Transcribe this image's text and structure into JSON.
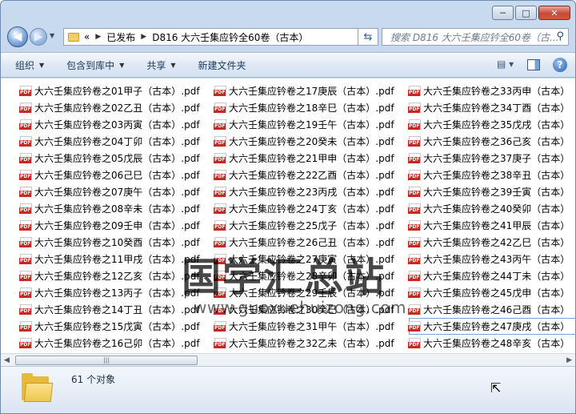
{
  "window": {
    "minimize": "─",
    "maximize": "□",
    "close": "✕"
  },
  "nav": {
    "back_icon": "back-arrow-icon",
    "forward_icon": "forward-arrow-icon"
  },
  "address": {
    "overflow": "«",
    "crumbs": [
      "已发布",
      "D816 大六壬集应钤全60卷（古本）"
    ]
  },
  "search": {
    "placeholder": "搜索 D816 大六壬集应钤全60卷（古..."
  },
  "toolbar": {
    "organize": "组织",
    "include_in_library": "包含到库中",
    "share": "共享",
    "new_folder": "新建文件夹"
  },
  "files": {
    "col1": [
      "大六壬集应钤卷之01甲子（古本）.pdf",
      "大六壬集应钤卷之02乙丑（古本）.pdf",
      "大六壬集应钤卷之03丙寅（古本）.pdf",
      "大六壬集应钤卷之04丁卯（古本）.pdf",
      "大六壬集应钤卷之05戊辰（古本）.pdf",
      "大六壬集应钤卷之06己巳（古本）.pdf",
      "大六壬集应钤卷之07庚午（古本）.pdf",
      "大六壬集应钤卷之08辛未（古本）.pdf",
      "大六壬集应钤卷之09壬申（古本）.pdf",
      "大六壬集应钤卷之10癸酉（古本）.pdf",
      "大六壬集应钤卷之11甲戌（古本）.pdf",
      "大六壬集应钤卷之12乙亥（古本）.pdf",
      "大六壬集应钤卷之13丙子（古本）.pdf",
      "大六壬集应钤卷之14丁丑（古本）.pdf",
      "大六壬集应钤卷之15戊寅（古本）.pdf",
      "大六壬集应钤卷之16己卯（古本）.pdf"
    ],
    "col2": [
      "大六壬集应钤卷之17庚辰（古本）.pdf",
      "大六壬集应钤卷之18辛巳（古本）.pdf",
      "大六壬集应钤卷之19壬午（古本）.pdf",
      "大六壬集应钤卷之20癸未（古本）.pdf",
      "大六壬集应钤卷之21甲申（古本）.pdf",
      "大六壬集应钤卷之22乙酉（古本）.pdf",
      "大六壬集应钤卷之23丙戌（古本）.pdf",
      "大六壬集应钤卷之24丁亥（古本）.pdf",
      "大六壬集应钤卷之25戊子（古本）.pdf",
      "大六壬集应钤卷之26己丑（古本）.pdf",
      "大六壬集应钤卷之27庚寅（古本）.pdf",
      "大六壬集应钤卷之28辛卯（古本）.pdf",
      "大六壬集应钤卷之29壬辰（古本）.pdf",
      "大六壬集应钤卷之30癸巳（古本）.pdf",
      "大六壬集应钤卷之31甲午（古本）.pdf",
      "大六壬集应钤卷之32乙未（古本）.pdf"
    ],
    "col3": [
      "大六壬集应钤卷之33丙申（古本）",
      "大六壬集应钤卷之34丁酉（古本）",
      "大六壬集应钤卷之35戊戌（古本）",
      "大六壬集应钤卷之36己亥（古本）",
      "大六壬集应钤卷之37庚子（古本）",
      "大六壬集应钤卷之38辛丑（古本）",
      "大六壬集应钤卷之39壬寅（古本）",
      "大六壬集应钤卷之40癸卯（古本）",
      "大六壬集应钤卷之41甲辰（古本）",
      "大六壬集应钤卷之42乙巳（古本）",
      "大六壬集应钤卷之43丙午（古本）",
      "大六壬集应钤卷之44丁未（古本）",
      "大六壬集应钤卷之45戊申（古本）",
      "大六壬集应钤卷之46己酉（古本）",
      "大六壬集应钤卷之47庚戌（古本）",
      "大六壬集应钤卷之48辛亥（古本）"
    ],
    "selected": "大六壬集应钤卷之47庚戌（古本）"
  },
  "status": {
    "count": "61 个对象"
  },
  "watermark": {
    "title": "国学汇总站",
    "url": "www.guoxuehuizong.com"
  }
}
